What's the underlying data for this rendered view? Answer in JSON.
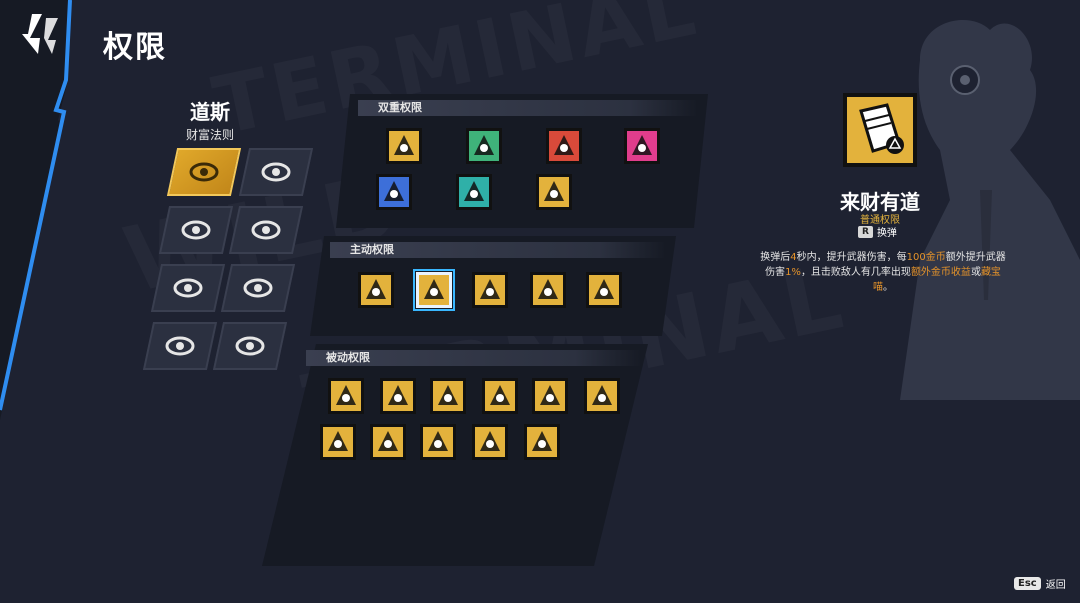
{
  "page": {
    "title": "权限"
  },
  "character": {
    "name": "道斯",
    "subtitle": "财富法则"
  },
  "character_icons": [
    {
      "name": "eye-icon",
      "active": true
    },
    {
      "name": "lightning-orb-icon",
      "active": false
    },
    {
      "name": "gamepad-icon",
      "active": false
    },
    {
      "name": "lightning-wing-icon",
      "active": false
    },
    {
      "name": "owl-face-icon",
      "active": false
    },
    {
      "name": "ring-orb-icon",
      "active": false
    },
    {
      "name": "cube-icon",
      "active": false
    },
    {
      "name": "horned-mask-icon",
      "active": false
    }
  ],
  "sections": {
    "dual": {
      "label": "双重权限",
      "icons": [
        "triangle-emblem-icon",
        "green-arrow-icon",
        "red-arrow-icon",
        "pink-triangle-icon",
        "blue-lightning-icon",
        "teal-tree-icon",
        "blue-gear-icon"
      ]
    },
    "active": {
      "label": "主动权限",
      "icons": [
        "dagger-icon",
        "ticket-icon",
        "wing-icon",
        "shell-burst-icon",
        "cash-icon"
      ]
    },
    "passive": {
      "label": "被动权限",
      "icons": [
        "coin-stack-icon",
        "cart-icon",
        "coin-icon",
        "money-bag-icon",
        "coin-pile-icon",
        "phone-icon",
        "fan-icon",
        "safe-icon",
        "gear-coin-icon",
        "hand-coin-icon",
        "gear-badge-icon"
      ]
    }
  },
  "detail": {
    "title": "来财有道",
    "type": "普通权限",
    "key": "R",
    "key_action": "换弹",
    "desc": {
      "p1": "换弹后",
      "h1": "4",
      "p2": "秒内，提升武器伤害，每",
      "h2": "100金币",
      "p3": "额外提升武器伤害",
      "h3": "1%",
      "p4": "，且击败敌人有几率出现",
      "h4": "额外金币收益",
      "p5": "或",
      "h5": "藏宝喵",
      "p6": "。"
    }
  },
  "footer": {
    "esc_key": "Esc",
    "esc_label": "返回"
  },
  "colors": {
    "accent_gold": "#e3b23c",
    "accent_blue": "#39b7ff",
    "highlight_orange": "#e5932a",
    "background": "#1e2231"
  }
}
